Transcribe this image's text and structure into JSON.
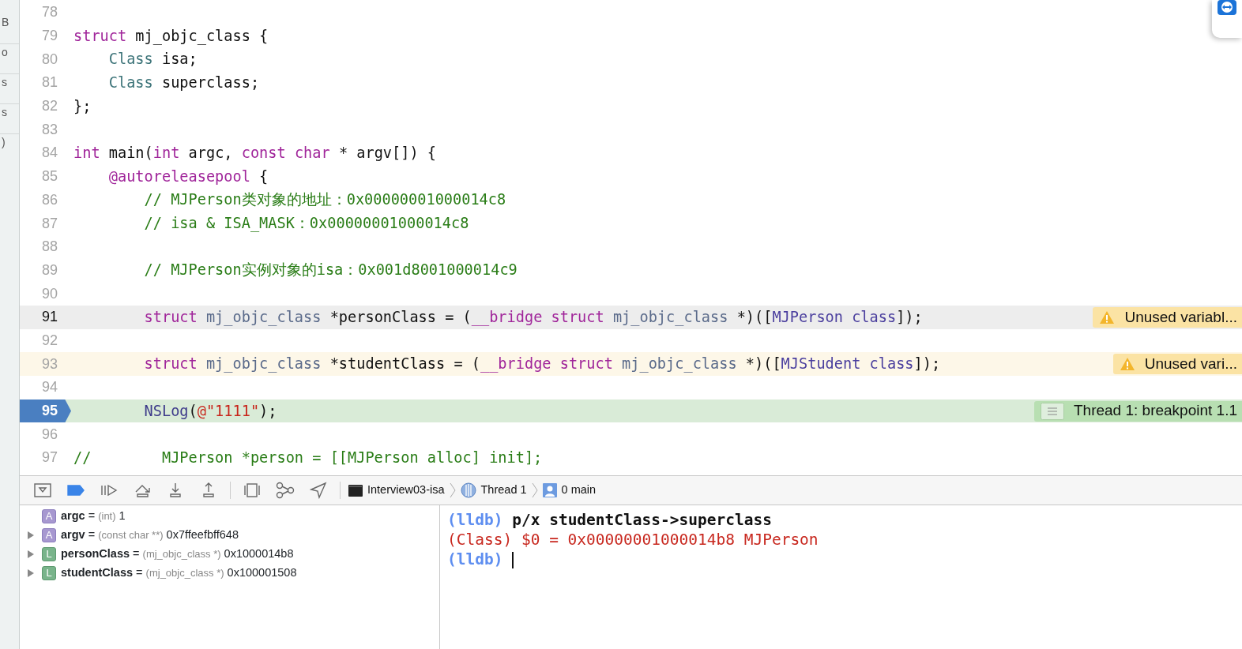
{
  "sidebar": {
    "items": [
      {
        "label": "B"
      },
      {
        "label": "o"
      },
      {
        "label": "s"
      },
      {
        "label": "s"
      },
      {
        "label": ")"
      }
    ]
  },
  "editor": {
    "lines": [
      {
        "number": "78",
        "current": false,
        "warning": false,
        "breakpoint": false
      },
      {
        "number": "79",
        "current": false,
        "warning": false,
        "breakpoint": false,
        "tokens": [
          {
            "kind": "keyword",
            "text": "struct"
          },
          {
            "kind": "plain",
            "text": " mj_objc_class {"
          }
        ]
      },
      {
        "number": "80",
        "current": false,
        "warning": false,
        "breakpoint": false,
        "tokens": [
          {
            "kind": "type",
            "text": "    Class"
          },
          {
            "kind": "plain",
            "text": " isa;"
          }
        ]
      },
      {
        "number": "81",
        "current": false,
        "warning": false,
        "breakpoint": false,
        "tokens": [
          {
            "kind": "type",
            "text": "    Class"
          },
          {
            "kind": "plain",
            "text": " superclass;"
          }
        ]
      },
      {
        "number": "82",
        "current": false,
        "warning": false,
        "breakpoint": false,
        "tokens": [
          {
            "kind": "plain",
            "text": "};"
          }
        ]
      },
      {
        "number": "83",
        "current": false,
        "warning": false,
        "breakpoint": false
      },
      {
        "number": "84",
        "current": false,
        "warning": false,
        "breakpoint": false,
        "tokens": [
          {
            "kind": "keyword",
            "text": "int"
          },
          {
            "kind": "plain",
            "text": " main("
          },
          {
            "kind": "keyword",
            "text": "int"
          },
          {
            "kind": "plain",
            "text": " argc, "
          },
          {
            "kind": "keyword",
            "text": "const char"
          },
          {
            "kind": "plain",
            "text": " * argv[]) {"
          }
        ]
      },
      {
        "number": "85",
        "current": false,
        "warning": false,
        "breakpoint": false,
        "tokens": [
          {
            "kind": "keyword",
            "text": "    @autoreleasepool"
          },
          {
            "kind": "plain",
            "text": " {"
          }
        ]
      },
      {
        "number": "86",
        "current": false,
        "warning": false,
        "breakpoint": false,
        "tokens": [
          {
            "kind": "comment",
            "text": "        // MJPerson类对象的地址：0x00000001000014c8"
          }
        ]
      },
      {
        "number": "87",
        "current": false,
        "warning": false,
        "breakpoint": false,
        "tokens": [
          {
            "kind": "comment",
            "text": "        // isa & ISA_MASK：0x00000001000014c8"
          }
        ]
      },
      {
        "number": "88",
        "current": false,
        "warning": false,
        "breakpoint": false
      },
      {
        "number": "89",
        "current": false,
        "warning": false,
        "breakpoint": false,
        "tokens": [
          {
            "kind": "comment",
            "text": "        // MJPerson实例对象的isa：0x001d8001000014c9"
          }
        ]
      },
      {
        "number": "90",
        "current": false,
        "warning": false,
        "breakpoint": false
      },
      {
        "number": "91",
        "current": true,
        "warning": false,
        "breakpoint": false,
        "tokens": [
          {
            "kind": "keyword",
            "text": "        struct"
          },
          {
            "kind": "usertype",
            "text": " mj_objc_class"
          },
          {
            "kind": "plain",
            "text": " *personClass = ("
          },
          {
            "kind": "keyword",
            "text": "__bridge struct"
          },
          {
            "kind": "usertype",
            "text": " mj_objc_class"
          },
          {
            "kind": "plain",
            "text": " *)(["
          },
          {
            "kind": "classname",
            "text": "MJPerson class"
          },
          {
            "kind": "plain",
            "text": "]);"
          }
        ],
        "annotation": {
          "kind": "warning",
          "text": "Unused variabl..."
        }
      },
      {
        "number": "92",
        "current": false,
        "warning": false,
        "breakpoint": false
      },
      {
        "number": "93",
        "current": false,
        "warning": true,
        "breakpoint": false,
        "tokens": [
          {
            "kind": "keyword",
            "text": "        struct"
          },
          {
            "kind": "usertype",
            "text": " mj_objc_class"
          },
          {
            "kind": "plain",
            "text": " *studentClass = ("
          },
          {
            "kind": "keyword",
            "text": "__bridge struct"
          },
          {
            "kind": "usertype",
            "text": " mj_objc_class"
          },
          {
            "kind": "plain",
            "text": " *)(["
          },
          {
            "kind": "classname",
            "text": "MJStudent class"
          },
          {
            "kind": "plain",
            "text": "]);"
          }
        ],
        "annotation": {
          "kind": "warning",
          "text": "Unused vari..."
        }
      },
      {
        "number": "94",
        "current": false,
        "warning": false,
        "breakpoint": false
      },
      {
        "number": "95",
        "current": false,
        "warning": false,
        "breakpoint": true,
        "tokens": [
          {
            "kind": "function",
            "text": "        NSLog"
          },
          {
            "kind": "plain",
            "text": "("
          },
          {
            "kind": "string",
            "text": "@\"1111\""
          },
          {
            "kind": "plain",
            "text": ");"
          }
        ],
        "annotation": {
          "kind": "thread",
          "text": "Thread 1: breakpoint 1.1"
        }
      },
      {
        "number": "96",
        "current": false,
        "warning": false,
        "breakpoint": false
      },
      {
        "number": "97",
        "current": false,
        "warning": false,
        "breakpoint": false,
        "tokens": [
          {
            "kind": "comment",
            "text": "//        MJPerson *person = [[MJPerson alloc] init];"
          }
        ]
      }
    ]
  },
  "debug_bar": {
    "breakpoints_active": true,
    "breadcrumbs": [
      {
        "kind": "process",
        "label": "Interview03-isa"
      },
      {
        "kind": "thread",
        "label": "Thread 1"
      },
      {
        "kind": "frame",
        "label": "0 main"
      }
    ]
  },
  "variables": [
    {
      "kind": "argument",
      "badge": "A",
      "expandable": false,
      "name": "argc",
      "operator": "=",
      "type": "(int)",
      "value": "1"
    },
    {
      "kind": "argument",
      "badge": "A",
      "expandable": true,
      "name": "argv",
      "operator": "=",
      "type": "(const char **)",
      "value": "0x7ffeefbff648"
    },
    {
      "kind": "local",
      "badge": "L",
      "expandable": true,
      "name": "personClass",
      "operator": "=",
      "type": "(mj_objc_class *)",
      "value": "0x1000014b8"
    },
    {
      "kind": "local",
      "badge": "L",
      "expandable": true,
      "name": "studentClass",
      "operator": "=",
      "type": "(mj_objc_class *)",
      "value": "0x100001508"
    }
  ],
  "console": {
    "lines": [
      {
        "segments": [
          {
            "kind": "prompt",
            "text": "(lldb)"
          },
          {
            "kind": "command",
            "text": " p/x studentClass->superclass"
          }
        ]
      },
      {
        "segments": [
          {
            "kind": "output",
            "text": "(Class) $0 = 0x00000001000014b8 MJPerson"
          }
        ]
      },
      {
        "segments": [
          {
            "kind": "prompt",
            "text": "(lldb)"
          }
        ],
        "cursor": true
      }
    ]
  }
}
